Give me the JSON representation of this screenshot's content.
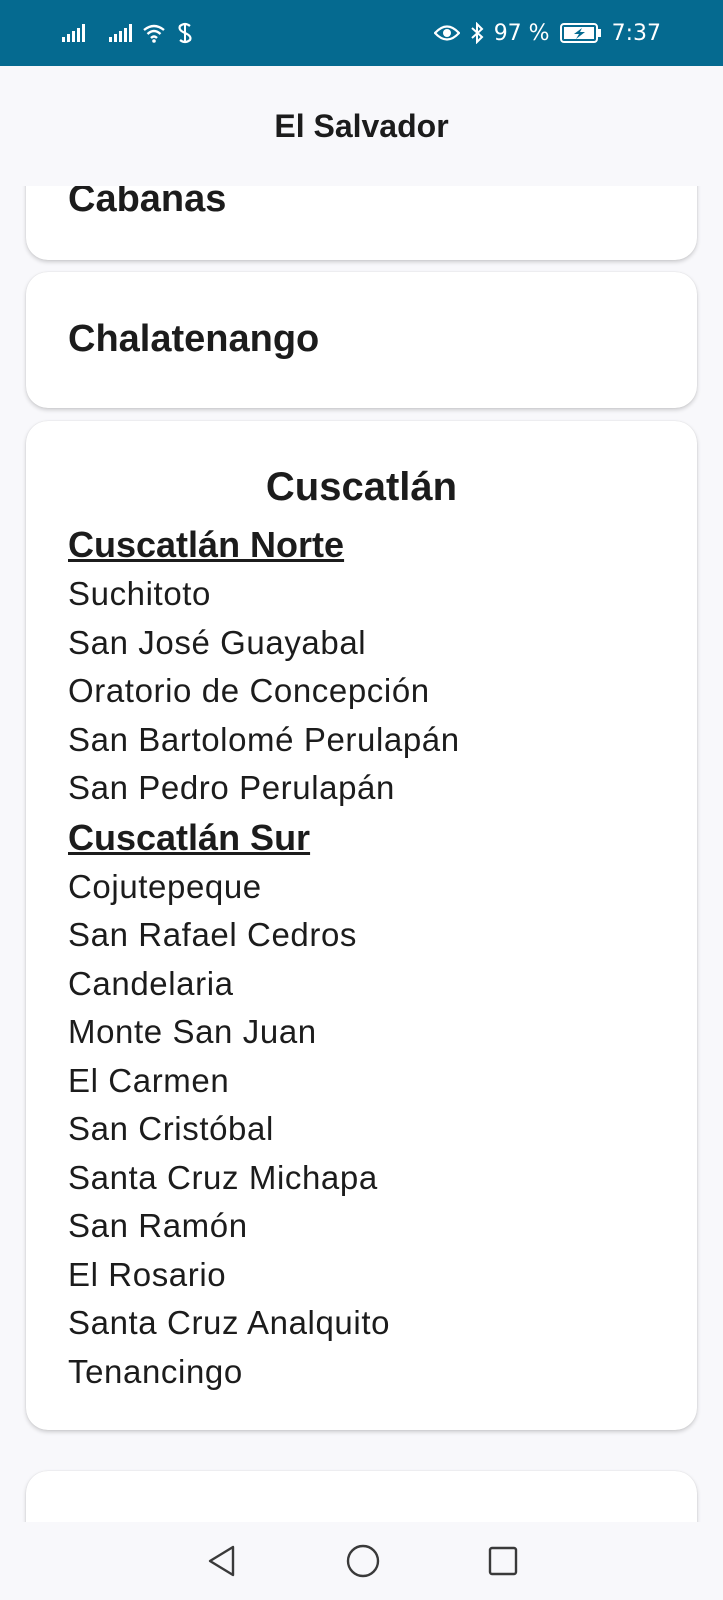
{
  "status_bar": {
    "battery_text": "97 %",
    "time": "7:37",
    "icons": [
      "signal-icon",
      "signal-icon",
      "wifi-icon",
      "data-saver-icon",
      "eye-icon",
      "bluetooth-icon",
      "battery-charging-icon"
    ]
  },
  "app_bar": {
    "title": "El Salvador"
  },
  "departments": [
    {
      "name": "Cabanas"
    },
    {
      "name": "Chalatenango"
    },
    {
      "name": "Cuscatlán",
      "groups": [
        {
          "title": "Cuscatlán Norte",
          "municipalities": [
            "Suchitoto",
            "San José Guayabal",
            "Oratorio de Concepción",
            "San Bartolomé Perulapán",
            "San Pedro Perulapán"
          ]
        },
        {
          "title": "Cuscatlán Sur",
          "municipalities": [
            "Cojutepeque",
            "San Rafael Cedros",
            "Candelaria",
            "Monte San Juan",
            "El Carmen",
            "San Cristóbal",
            "Santa Cruz Michapa",
            "San Ramón",
            "El Rosario",
            "Santa Cruz Analquito",
            "Tenancingo"
          ]
        }
      ]
    }
  ],
  "nav_bar": {
    "buttons": [
      "back",
      "home",
      "recents"
    ]
  },
  "colors": {
    "status_bar": "#056a90",
    "background": "#f8f8fb",
    "card": "#ffffff",
    "text": "#1c1c1c"
  }
}
